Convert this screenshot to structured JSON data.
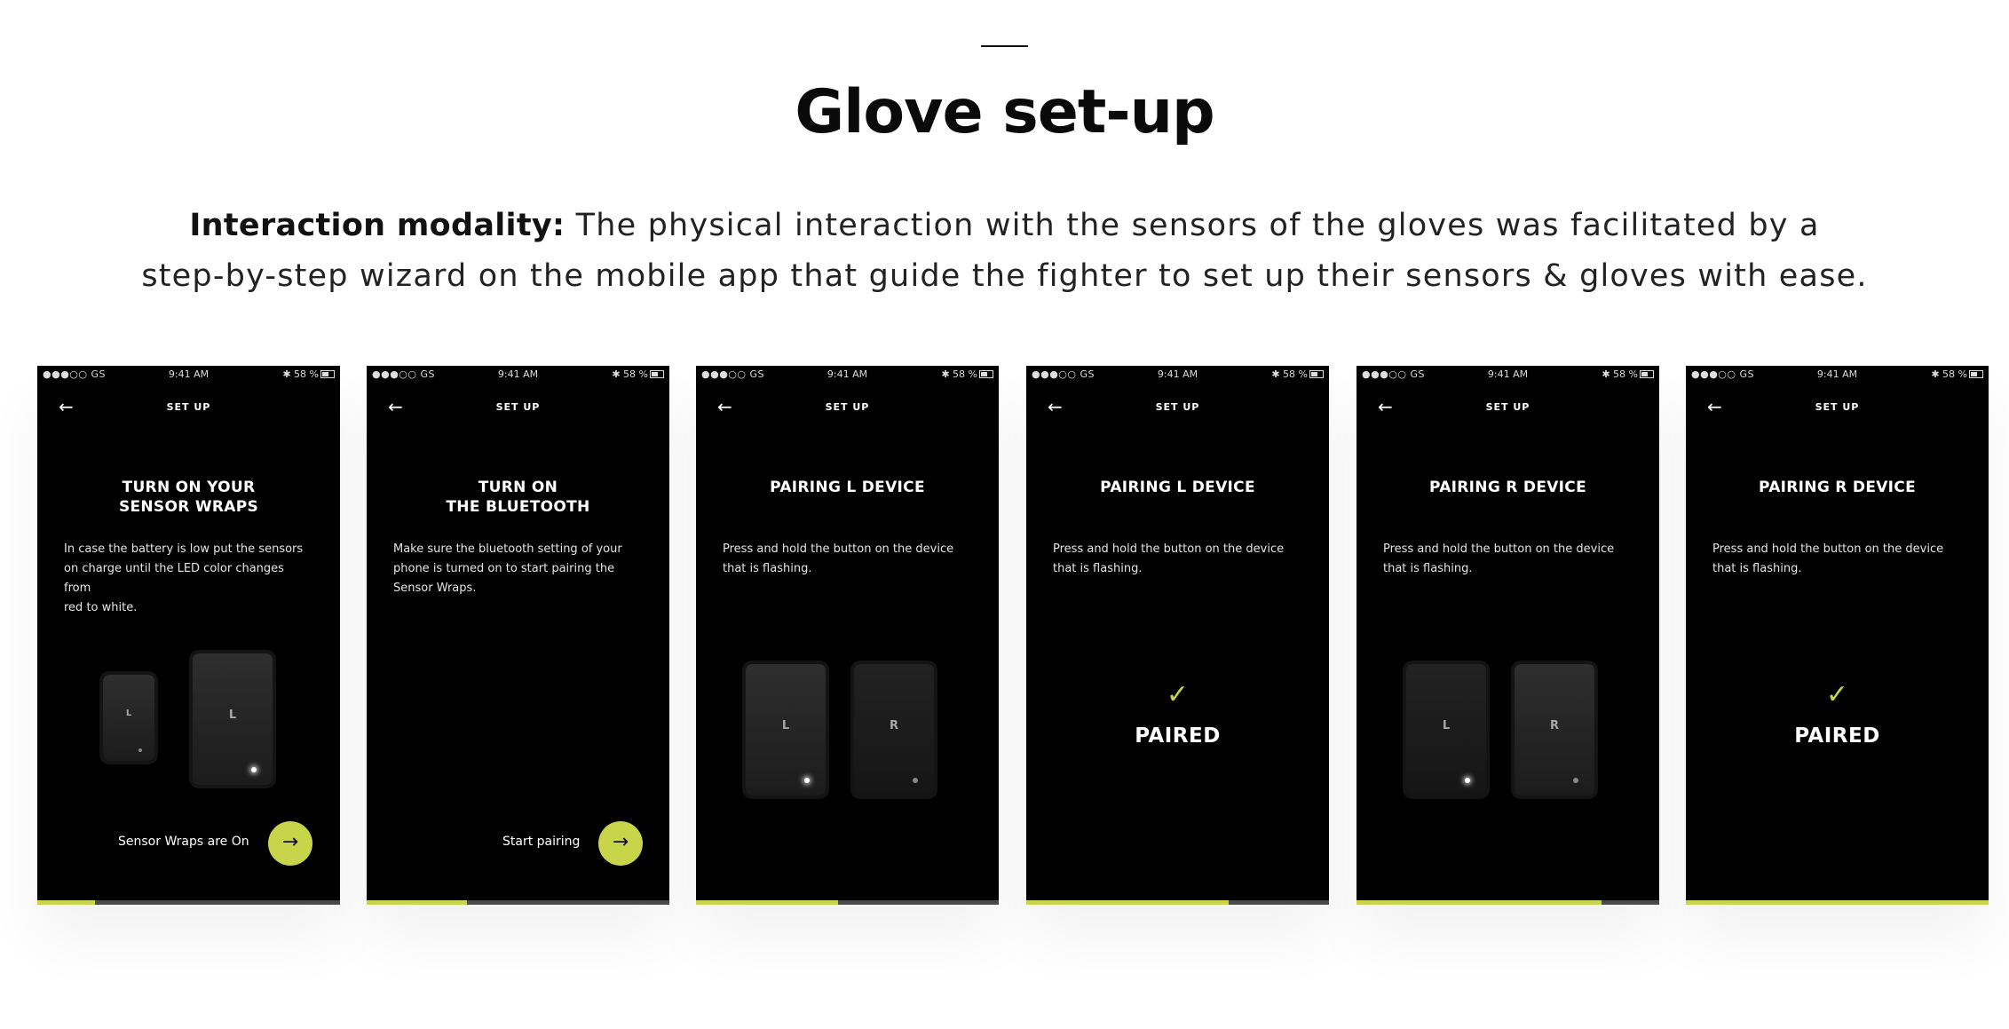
{
  "page": {
    "title": "Glove set-up",
    "intro_bold": "Interaction modality:",
    "intro_line1": " The physical interaction with the sensors of the gloves was facilitated by a",
    "intro_line2": "step-by-step wizard on the mobile app that guide the fighter to set up their sensors & gloves with ease."
  },
  "status_bar": {
    "carrier": "●●●○○ GS",
    "time": "9:41 AM",
    "battery": "✱ 58 %"
  },
  "icons": {
    "back": "arrow-left-icon",
    "next": "arrow-right-icon",
    "check": "checkmark-icon",
    "wifi": "wifi-icon",
    "bluetooth": "bluetooth-icon",
    "battery": "battery-icon"
  },
  "colors": {
    "accent": "#c8d44a",
    "screen_bg": "#000000",
    "progress_track": "#4a4a4a"
  },
  "screens": [
    {
      "nav_title": "SET UP",
      "title": "TURN ON YOUR\nSENSOR WRAPS",
      "description": "In case the battery is low put the sensors\non charge until the LED color changes from\nred to white.",
      "devices": [
        {
          "label": "L"
        },
        {
          "label": "L"
        }
      ],
      "cta_label": "Sensor Wraps are On",
      "progress": 0.19
    },
    {
      "nav_title": "SET UP",
      "title": "TURN ON\nTHE BLUETOOTH",
      "description": "Make sure the bluetooth setting of your\nphone is turned on to start pairing the\nSensor Wraps.",
      "cta_label": "Start pairing",
      "progress": 0.33
    },
    {
      "nav_title": "SET UP",
      "title": "PAIRING L DEVICE",
      "description": "Press and hold the button on the device\nthat is flashing.",
      "devices": [
        {
          "label": "L"
        },
        {
          "label": "R"
        }
      ],
      "progress": 0.47
    },
    {
      "nav_title": "SET UP",
      "title": "PAIRING L DEVICE",
      "description": "Press and hold the button on the device\nthat is flashing.",
      "status_label": "PAIRED",
      "progress": 0.67
    },
    {
      "nav_title": "SET UP",
      "title": "PAIRING R DEVICE",
      "description": "Press and hold the button on the device\nthat is flashing.",
      "devices": [
        {
          "label": "L"
        },
        {
          "label": "R"
        }
      ],
      "progress": 0.81
    },
    {
      "nav_title": "SET UP",
      "title": "PAIRING R DEVICE",
      "description": "Press and hold the button on the device\nthat is flashing.",
      "status_label": "PAIRED",
      "progress": 1.0
    }
  ]
}
